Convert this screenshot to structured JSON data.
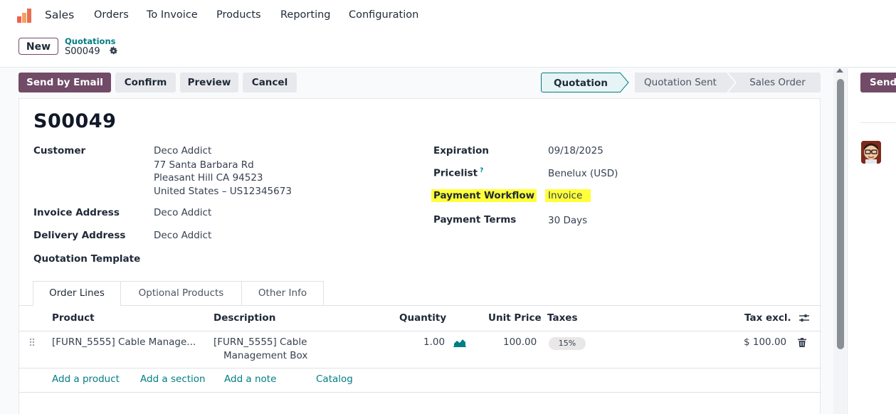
{
  "navbar": {
    "app_name": "Sales",
    "menus": [
      "Orders",
      "To Invoice",
      "Products",
      "Reporting",
      "Configuration"
    ]
  },
  "control": {
    "new_label": "New",
    "breadcrumb_parent": "Quotations",
    "breadcrumb_current": "S00049"
  },
  "status_bar": {
    "buttons": [
      "Send by Email",
      "Confirm",
      "Preview",
      "Cancel"
    ],
    "stages": [
      "Quotation",
      "Quotation Sent",
      "Sales Order"
    ],
    "active_stage": "Quotation"
  },
  "form": {
    "name": "S00049",
    "customer_label": "Customer",
    "customer_lines": [
      "Deco Addict",
      "77 Santa Barbara Rd",
      "Pleasant Hill CA 94523",
      "United States – US12345673"
    ],
    "invoice_address_label": "Invoice Address",
    "invoice_address": "Deco Addict",
    "delivery_address_label": "Delivery Address",
    "delivery_address": "Deco Addict",
    "quotation_template_label": "Quotation Template",
    "expiration_label": "Expiration",
    "expiration": "09/18/2025",
    "pricelist_label": "Pricelist",
    "pricelist_help": "?",
    "pricelist": "Benelux (USD)",
    "payment_workflow_label": "Payment Workflow",
    "payment_workflow": "Invoice",
    "payment_terms_label": "Payment Terms",
    "payment_terms": "30 Days",
    "highlight_color": "#ffff3a"
  },
  "tabs": [
    "Order Lines",
    "Optional Products",
    "Other Info"
  ],
  "order_lines": {
    "headers": {
      "product": "Product",
      "description": "Description",
      "quantity": "Quantity",
      "unit_price": "Unit Price",
      "taxes": "Taxes",
      "tax_excl": "Tax excl."
    },
    "rows": [
      {
        "product": "[FURN_5555] Cable Manage...",
        "description_line1": "[FURN_5555] Cable",
        "description_line2": "Management Box",
        "quantity": "1.00",
        "unit_price": "100.00",
        "tax": "15%",
        "subtotal": "$ 100.00"
      }
    ],
    "add_links": [
      "Add a product",
      "Add a section",
      "Add a note",
      "Catalog"
    ]
  },
  "chatter": {
    "send_label": "Send"
  },
  "colors": {
    "primary": "#714b67",
    "link": "#017e84"
  }
}
